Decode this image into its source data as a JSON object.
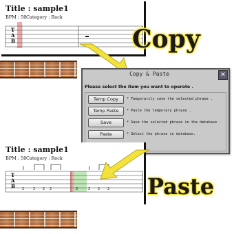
{
  "top_panel": {
    "title": "Title : sample1",
    "bpm": "BPM : 50",
    "category": "Category : Rock",
    "tab_letters": [
      "T",
      "A",
      "B"
    ]
  },
  "bottom_panel": {
    "title": "Title : sample1",
    "bpm": "BPM : 50",
    "category": "Category : Rock",
    "tab_letters": [
      "T",
      "A",
      "B"
    ],
    "fret_numbers": [
      "2",
      "2",
      "2",
      "2",
      "2",
      "2",
      "2",
      "2"
    ]
  },
  "labels": {
    "copy": "Copy",
    "paste": "Paste"
  },
  "dialog": {
    "title": "Copy & Paste",
    "close": "✕",
    "instruction": "Please select the item you want to operate .",
    "items": [
      {
        "label": "Temp Copy",
        "description": "* Temporarily save the selected phrase ."
      },
      {
        "label": "Temp Paste",
        "description": "* Paste the temporary phrase ."
      },
      {
        "label": "Save",
        "description": "* Save the selected phrase in the database ."
      },
      {
        "label": "Paste",
        "description": "* Select the phrase in database."
      }
    ]
  },
  "colors": {
    "highlight_red": "#f2a8a8",
    "highlight_green": "#bfe8b8",
    "arrow_yellow": "#f3e23c",
    "label_glow": "#f5e23a",
    "fretboard": "#a8633a"
  }
}
